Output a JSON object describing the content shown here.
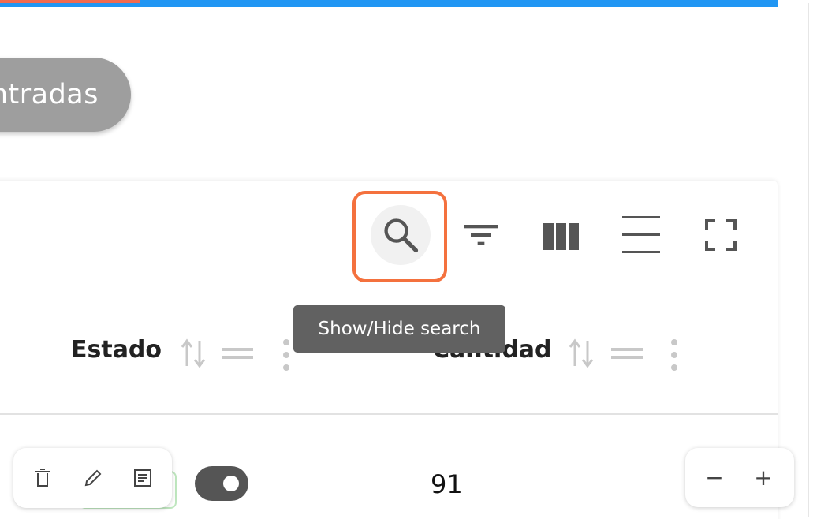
{
  "header": {
    "entries_button_label": "ntradas"
  },
  "toolbar": {
    "search_tooltip": "Show/Hide search",
    "icons": [
      "search-icon",
      "filter-list-icon",
      "view-columns-icon",
      "density-icon",
      "fullscreen-icon"
    ]
  },
  "table": {
    "columns": [
      {
        "title": "Estado"
      },
      {
        "title": "Cantidad"
      }
    ],
    "rows": [
      {
        "cantidad": "91"
      }
    ]
  },
  "row_actions": [
    "delete-icon",
    "edit-icon",
    "details-icon"
  ],
  "zoom": {
    "minus_label": "−",
    "plus_label": "+"
  },
  "colors": {
    "accent_blue": "#2196f3",
    "accent_red": "#f26a4f",
    "focus_orange": "#f4713e",
    "pill_gray": "#9e9e9e",
    "tooltip_gray": "#616161"
  }
}
